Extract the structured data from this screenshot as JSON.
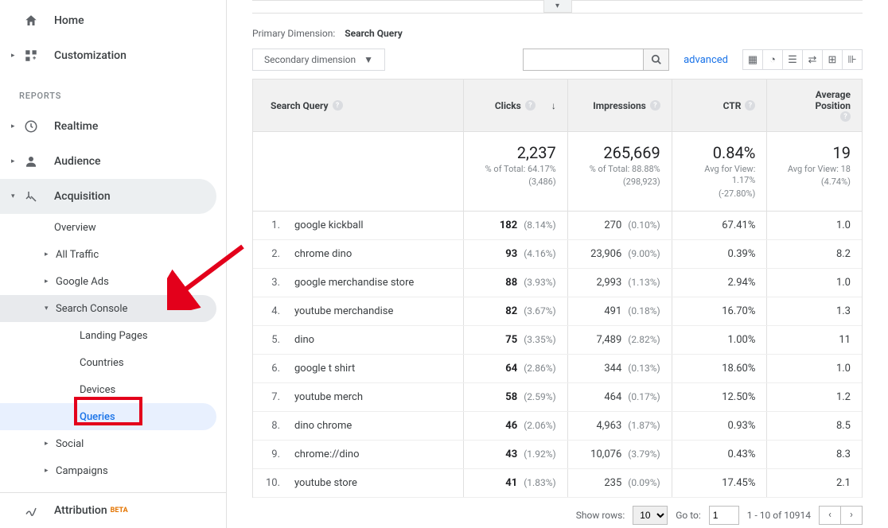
{
  "sidebar": {
    "home": "Home",
    "customization": "Customization",
    "reports_label": "REPORTS",
    "realtime": "Realtime",
    "audience": "Audience",
    "acquisition": {
      "label": "Acquisition",
      "overview": "Overview",
      "all_traffic": "All Traffic",
      "google_ads": "Google Ads",
      "search_console": {
        "label": "Search Console",
        "landing_pages": "Landing Pages",
        "countries": "Countries",
        "devices": "Devices",
        "queries": "Queries"
      },
      "social": "Social",
      "campaigns": "Campaigns"
    },
    "attribution": "Attribution",
    "beta_badge": "BETA"
  },
  "main": {
    "primary_dimension_label": "Primary Dimension:",
    "primary_dimension_value": "Search Query",
    "secondary_dimension": "Secondary dimension",
    "advanced_link": "advanced",
    "columns": {
      "query": "Search Query",
      "clicks": "Clicks",
      "impressions": "Impressions",
      "ctr": "CTR",
      "avg_position": "Average Position"
    },
    "totals": {
      "clicks": {
        "value": "2,237",
        "sub1": "% of Total: 64.17%",
        "sub2": "(3,486)"
      },
      "impressions": {
        "value": "265,669",
        "sub1": "% of Total: 88.88%",
        "sub2": "(298,923)"
      },
      "ctr": {
        "value": "0.84%",
        "sub1": "Avg for View: 1.17%",
        "sub2": "(-27.80%)"
      },
      "avg_position": {
        "value": "19",
        "sub1": "Avg for View: 18",
        "sub2": "(4.74%)"
      }
    },
    "rows": [
      {
        "n": "1.",
        "query": "google kickball",
        "clicks": "182",
        "clicks_pct": "(8.14%)",
        "imp": "270",
        "imp_pct": "(0.10%)",
        "ctr": "67.41%",
        "ap": "1.0"
      },
      {
        "n": "2.",
        "query": "chrome dino",
        "clicks": "93",
        "clicks_pct": "(4.16%)",
        "imp": "23,906",
        "imp_pct": "(9.00%)",
        "ctr": "0.39%",
        "ap": "8.2"
      },
      {
        "n": "3.",
        "query": "google merchandise store",
        "clicks": "88",
        "clicks_pct": "(3.93%)",
        "imp": "2,993",
        "imp_pct": "(1.13%)",
        "ctr": "2.94%",
        "ap": "1.0"
      },
      {
        "n": "4.",
        "query": "youtube merchandise",
        "clicks": "82",
        "clicks_pct": "(3.67%)",
        "imp": "491",
        "imp_pct": "(0.18%)",
        "ctr": "16.70%",
        "ap": "1.3"
      },
      {
        "n": "5.",
        "query": "dino",
        "clicks": "75",
        "clicks_pct": "(3.35%)",
        "imp": "7,489",
        "imp_pct": "(2.82%)",
        "ctr": "1.00%",
        "ap": "11"
      },
      {
        "n": "6.",
        "query": "google t shirt",
        "clicks": "64",
        "clicks_pct": "(2.86%)",
        "imp": "344",
        "imp_pct": "(0.13%)",
        "ctr": "18.60%",
        "ap": "1.0"
      },
      {
        "n": "7.",
        "query": "youtube merch",
        "clicks": "58",
        "clicks_pct": "(2.59%)",
        "imp": "464",
        "imp_pct": "(0.17%)",
        "ctr": "12.50%",
        "ap": "1.2"
      },
      {
        "n": "8.",
        "query": "dino chrome",
        "clicks": "46",
        "clicks_pct": "(2.06%)",
        "imp": "4,963",
        "imp_pct": "(1.87%)",
        "ctr": "0.93%",
        "ap": "8.5"
      },
      {
        "n": "9.",
        "query": "chrome://dino",
        "clicks": "43",
        "clicks_pct": "(1.92%)",
        "imp": "10,076",
        "imp_pct": "(3.79%)",
        "ctr": "0.43%",
        "ap": "8.3"
      },
      {
        "n": "10.",
        "query": "youtube store",
        "clicks": "41",
        "clicks_pct": "(1.83%)",
        "imp": "235",
        "imp_pct": "(0.09%)",
        "ctr": "17.45%",
        "ap": "2.1"
      }
    ],
    "pagination": {
      "show_rows_label": "Show rows:",
      "show_rows_value": "10",
      "goto_label": "Go to:",
      "goto_value": "1",
      "range": "1 - 10 of 10914"
    }
  }
}
